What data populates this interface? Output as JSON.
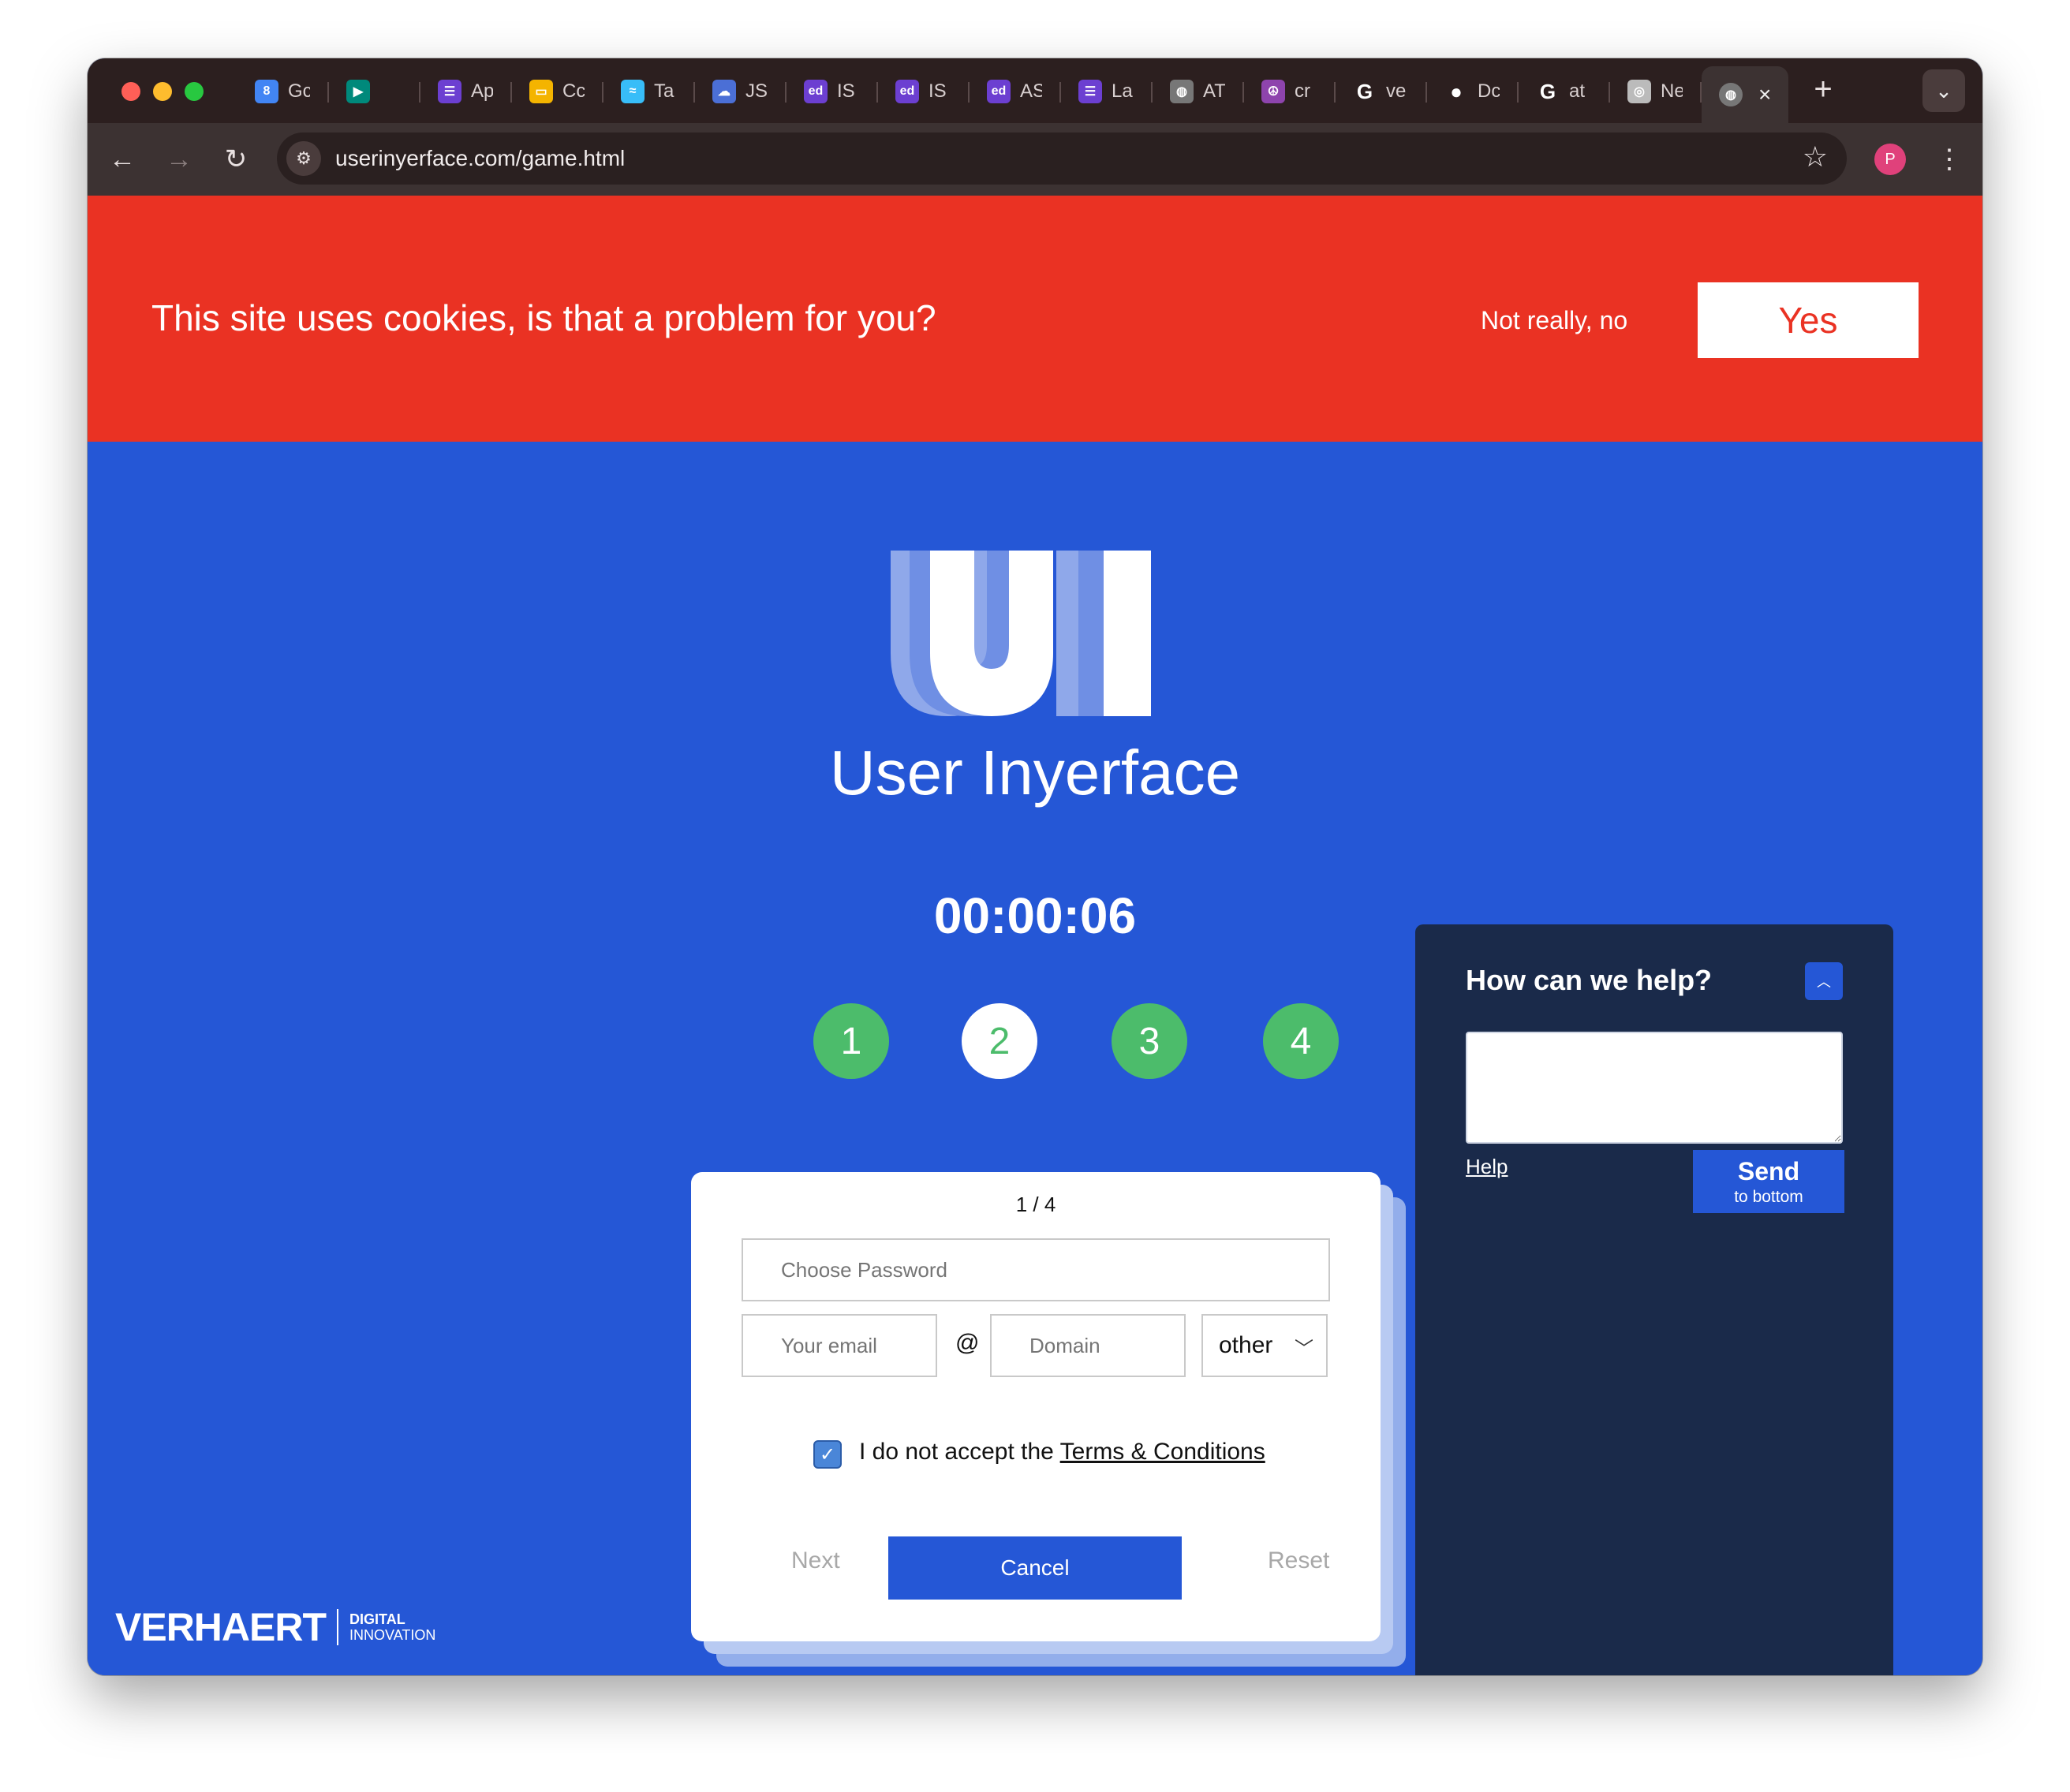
{
  "browser": {
    "tabs": [
      {
        "title": "Gc",
        "icon": "google-calendar-icon",
        "color": "#4285f4",
        "glyph": "8"
      },
      {
        "title": "",
        "icon": "google-meet-icon",
        "color": "#00897b",
        "glyph": "▶"
      },
      {
        "title": "Ap",
        "icon": "list-app-icon",
        "color": "#6c3fd1",
        "glyph": "☰"
      },
      {
        "title": "Cc",
        "icon": "google-slides-icon",
        "color": "#f4b400",
        "glyph": "▭"
      },
      {
        "title": "Ta",
        "icon": "tailwind-icon",
        "color": "#38bdf8",
        "glyph": "≈"
      },
      {
        "title": "JS",
        "icon": "cloud-icon",
        "color": "#4b6fd6",
        "glyph": "☁"
      },
      {
        "title": "IS",
        "icon": "ed-icon",
        "color": "#6c3fd1",
        "glyph": "ed"
      },
      {
        "title": "IS",
        "icon": "ed-icon",
        "color": "#6c3fd1",
        "glyph": "ed"
      },
      {
        "title": "AS",
        "icon": "ed-icon",
        "color": "#6c3fd1",
        "glyph": "ed"
      },
      {
        "title": "La",
        "icon": "list-app-icon",
        "color": "#6c3fd1",
        "glyph": "☰"
      },
      {
        "title": "AT",
        "icon": "globe-icon",
        "color": "#777777",
        "glyph": "◍"
      },
      {
        "title": "cr",
        "icon": "peace-icon",
        "color": "#8e44ad",
        "glyph": "☮"
      },
      {
        "title": "ve",
        "icon": "google-icon",
        "color": "#ffffff",
        "glyph": "G"
      },
      {
        "title": "Dc",
        "icon": "github-icon",
        "color": "#ffffff",
        "glyph": "●"
      },
      {
        "title": "at",
        "icon": "google-icon",
        "color": "#ffffff",
        "glyph": "G"
      },
      {
        "title": "Ne",
        "icon": "chrome-icon",
        "color": "#bbbbbb",
        "glyph": "◎"
      }
    ],
    "active_tab_icon": "globe-icon",
    "new_tab": "+",
    "url": "userinyerface.com/game.html",
    "profile_initial": "P"
  },
  "cookie_banner": {
    "message": "This site uses cookies, is that a problem for you?",
    "decline_label": "Not really, no",
    "accept_label": "Yes"
  },
  "app": {
    "title": "User Inyerface",
    "timer": "00:00:06",
    "steps": [
      "1",
      "2",
      "3",
      "4"
    ],
    "current_step": 2
  },
  "form": {
    "page_indicator": "1 / 4",
    "password_placeholder": "Choose Password",
    "email_placeholder": "Your email",
    "at_symbol": "@",
    "domain_placeholder": "Domain",
    "tld_selected": "other",
    "terms_prefix": "I do not accept the",
    "terms_link": "Terms & Conditions",
    "terms_checked": true,
    "next_label": "Next",
    "cancel_label": "Cancel",
    "reset_label": "Reset"
  },
  "help_widget": {
    "title": "How can we help?",
    "help_link": "Help",
    "send_label": "Send",
    "send_sublabel": "to bottom"
  },
  "footer": {
    "brand": "VERHAERT",
    "brand_line1": "DIGITAL",
    "brand_line2": "INNOVATION"
  },
  "colors": {
    "page_blue": "#2557d6",
    "cookie_red": "#ea3223",
    "step_green": "#4cbc6b",
    "help_navy": "#1a2a4a"
  }
}
